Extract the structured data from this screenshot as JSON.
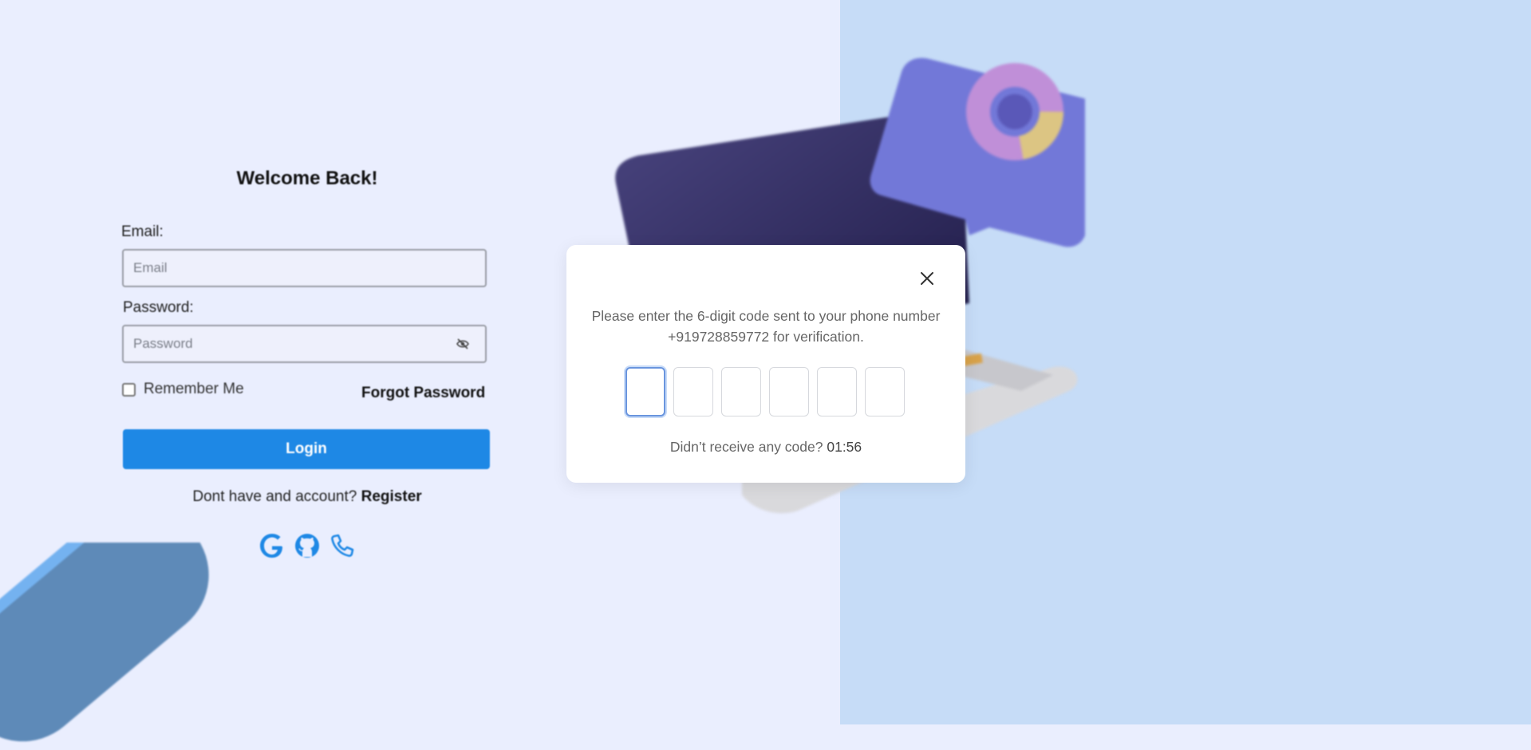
{
  "login": {
    "title": "Welcome Back!",
    "email_label": "Email:",
    "email_placeholder": "Email",
    "password_label": "Password:",
    "password_placeholder": "Password",
    "remember_label": "Remember Me",
    "forgot_label": "Forgot Password",
    "login_button": "Login",
    "register_prompt": "Dont have and account?",
    "register_link": "Register",
    "social_icons": [
      "google-icon",
      "github-icon",
      "phone-icon"
    ]
  },
  "otp_modal": {
    "message_line1": "Please enter the 6-digit code sent to your phone number",
    "message_line2": "+919728859772 for verification.",
    "digits": [
      "",
      "",
      "",
      "",
      "",
      ""
    ],
    "resend_prompt": "Didn’t receive any code?",
    "timer": "01:56"
  },
  "colors": {
    "left_bg": "#eaeefe",
    "right_bg": "#c6dcf7",
    "primary": "#1e88e5",
    "modal_bg": "#ffffff"
  }
}
